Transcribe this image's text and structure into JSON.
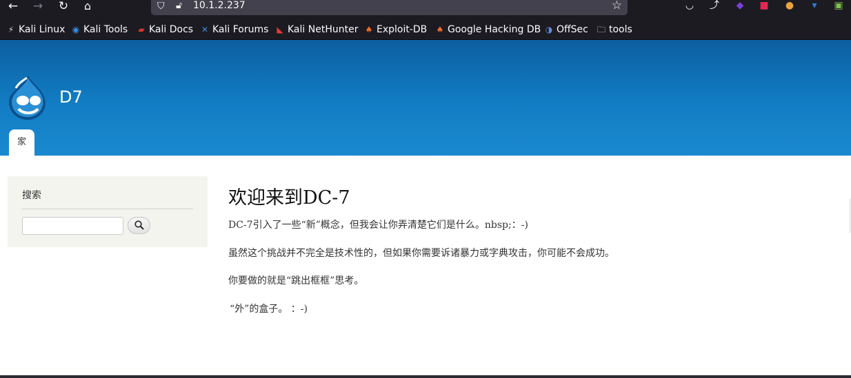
{
  "browser": {
    "url": "10.1.2.237",
    "icons": {
      "back": "back-arrow-icon",
      "forward": "forward-arrow-icon",
      "reload": "reload-icon",
      "home": "home-icon",
      "bookmark_star": "star-icon",
      "pocket": "pocket-icon"
    },
    "bookmarks": [
      {
        "label": "Kali Linux",
        "icon": "kali-dragon-icon"
      },
      {
        "label": "Kali Tools",
        "icon": "kali-tools-icon"
      },
      {
        "label": "Kali Docs",
        "icon": "kali-docs-icon"
      },
      {
        "label": "Kali Forums",
        "icon": "kali-forums-icon"
      },
      {
        "label": "Kali NetHunter",
        "icon": "nethunter-icon"
      },
      {
        "label": "Exploit-DB",
        "icon": "exploit-db-icon"
      },
      {
        "label": "Google Hacking DB",
        "icon": "ghdb-icon"
      },
      {
        "label": "OffSec",
        "icon": "offsec-icon"
      },
      {
        "label": "tools",
        "icon": "folder-icon"
      }
    ]
  },
  "site": {
    "name": "D7",
    "nav": {
      "home_tab": "家"
    }
  },
  "sidebar": {
    "search_title": "搜索",
    "search_value": "",
    "search_button_icon": "magnifier-icon"
  },
  "main": {
    "title": "欢迎来到DC-7",
    "paragraphs": [
      "DC-7引入了一些“新”概念，但我会让你弄清楚它们是什么。nbsp;：-)",
      "虽然这个挑战并不完全是技术性的，但如果你需要诉诸暴力或字典攻击，你可能不会成功。",
      "你要做的就是“跳出框框”思考。",
      "“外”的盒子。 ：-)"
    ]
  },
  "colors": {
    "header_top": "#0c5fa0",
    "header_bottom": "#1a89cf",
    "sidebar_bg": "#f4f4ef",
    "chrome_bg": "#1c1b22"
  }
}
